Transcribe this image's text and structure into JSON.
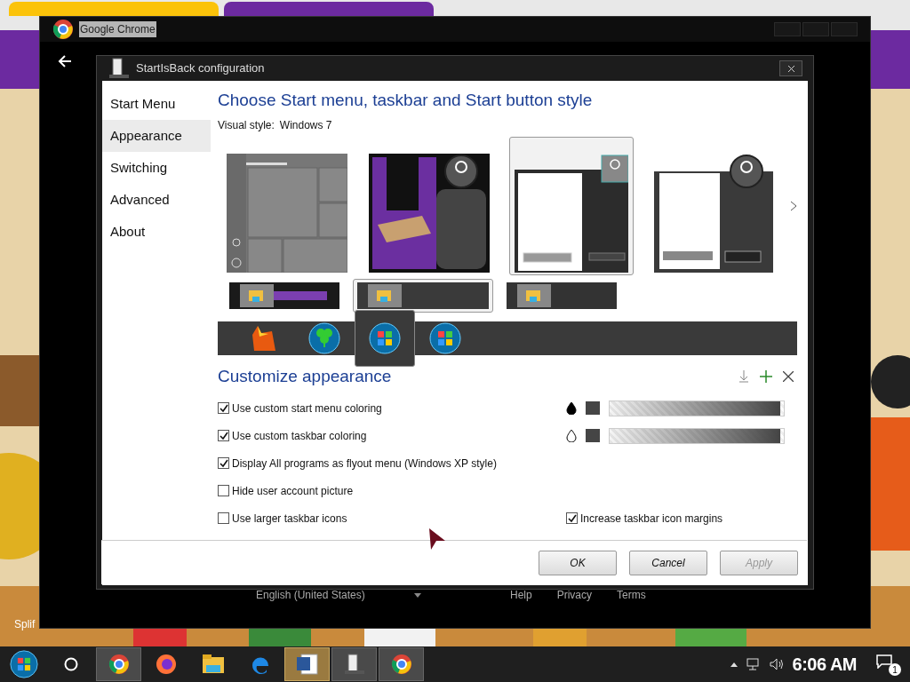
{
  "browser": {
    "tabs": [
      {
        "selected": false
      },
      {
        "selected": true
      }
    ]
  },
  "wallpaper": {
    "kind": "picture",
    "caption": "Splif"
  },
  "chrome_window": {
    "title": "Google Chrome",
    "footer": {
      "language": "English (United States)",
      "links": [
        "Help",
        "Privacy",
        "Terms"
      ]
    }
  },
  "dialog": {
    "title": "StartIsBack configuration",
    "sidebar": [
      {
        "label": "Start Menu",
        "selected": false
      },
      {
        "label": "Appearance",
        "selected": true
      },
      {
        "label": "Switching",
        "selected": false
      },
      {
        "label": "Advanced",
        "selected": false
      },
      {
        "label": "About",
        "selected": false
      }
    ],
    "heading": "Choose Start menu, taskbar and Start button style",
    "visual_style": {
      "label": "Visual style:",
      "value": "Windows 7"
    },
    "start_menu_styles": [
      {
        "kind": "tiles",
        "selected": false
      },
      {
        "kind": "art",
        "selected": false
      },
      {
        "kind": "light",
        "selected": true
      },
      {
        "kind": "plain",
        "selected": false
      }
    ],
    "taskbar_styles": [
      {
        "kind": "art",
        "selected": false
      },
      {
        "kind": "glass",
        "selected": true
      },
      {
        "kind": "flat",
        "selected": false
      }
    ],
    "start_buttons": [
      {
        "kind": "emblem",
        "selected": false
      },
      {
        "kind": "clover",
        "selected": false
      },
      {
        "kind": "windows",
        "selected": true
      },
      {
        "kind": "windows-flat",
        "selected": false
      }
    ],
    "customize_heading": "Customize appearance",
    "option_rows": [
      {
        "left": {
          "label": "Use custom start menu coloring",
          "checked": true
        },
        "right": {
          "kind": "slider",
          "level": 0.98
        }
      },
      {
        "left": {
          "label": "Use custom taskbar coloring",
          "checked": true
        },
        "right": {
          "kind": "slider",
          "level": 0.98
        }
      },
      {
        "left": {
          "label": "Display All programs as flyout menu (Windows XP style)",
          "checked": true
        }
      },
      {
        "left": {
          "label": "Hide user account picture",
          "checked": false
        }
      },
      {
        "left": {
          "label": "Use larger taskbar icons",
          "checked": false
        },
        "right": {
          "kind": "checkbox",
          "label": "Increase taskbar icon margins",
          "checked": true
        }
      }
    ],
    "buttons": [
      {
        "label": "OK",
        "disabled": false
      },
      {
        "label": "Cancel",
        "disabled": false
      },
      {
        "label": "Apply",
        "disabled": true
      }
    ]
  },
  "taskbar": {
    "apps": [
      {
        "kind": "chrome-profile",
        "running": true
      },
      {
        "kind": "firefox",
        "running": false
      },
      {
        "kind": "folder",
        "running": false
      },
      {
        "kind": "edge",
        "running": false
      },
      {
        "kind": "word",
        "running": true
      },
      {
        "kind": "startisback",
        "running": true
      },
      {
        "kind": "chrome",
        "running": true
      }
    ],
    "clock": "6:06 AM",
    "notifications": "1"
  }
}
